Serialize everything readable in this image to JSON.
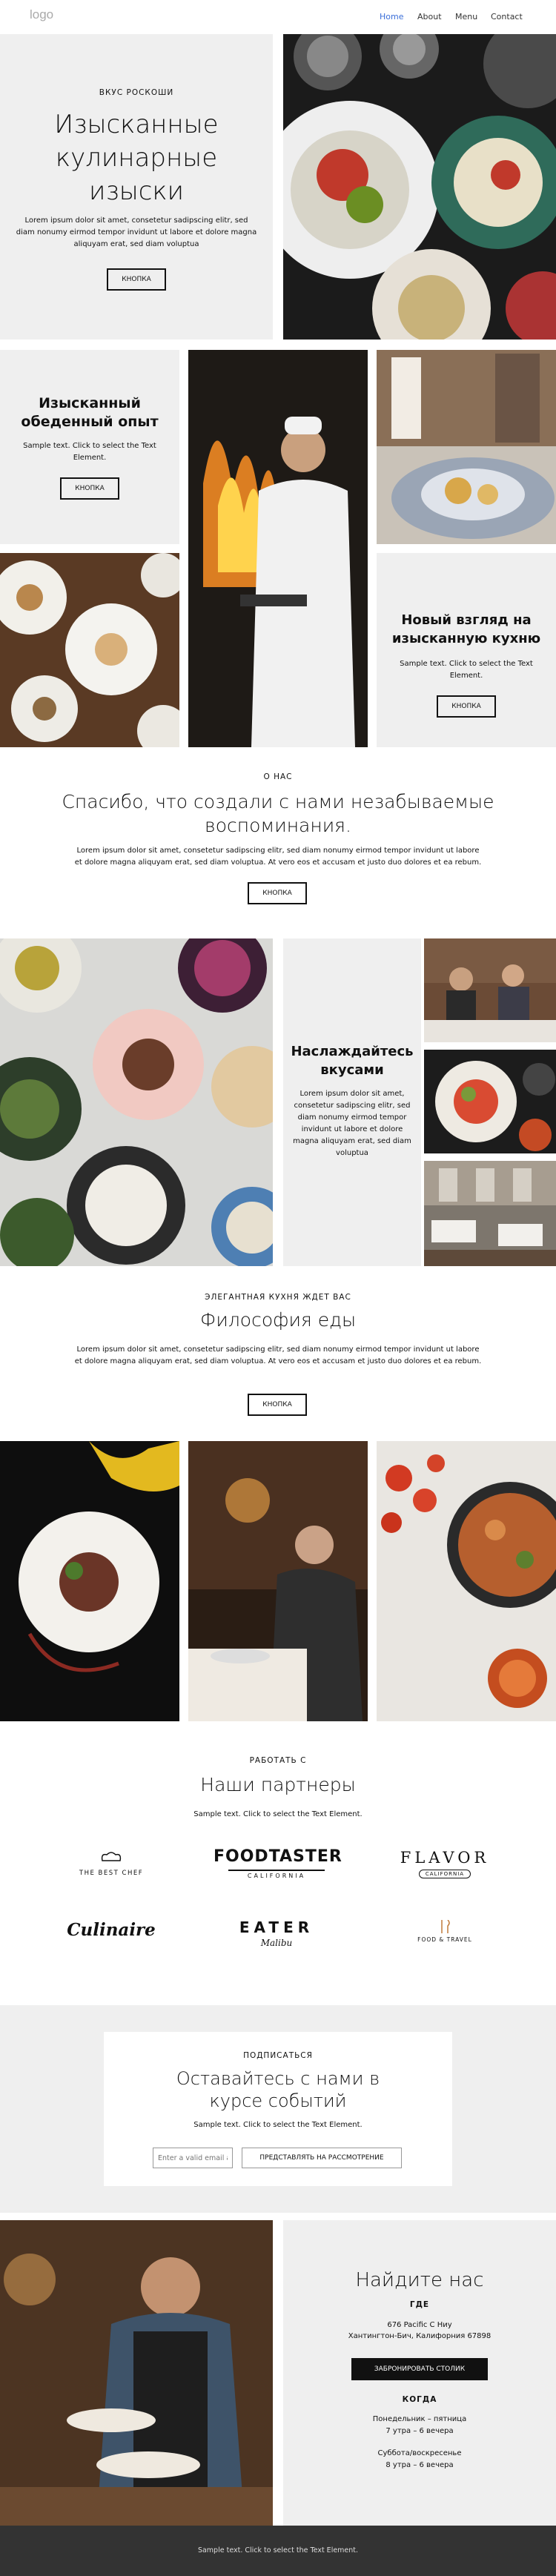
{
  "header": {
    "logo": "logo",
    "nav": [
      "Home",
      "About",
      "Menu",
      "Contact"
    ],
    "active_color": "#3b6fd9"
  },
  "hero": {
    "eyebrow": "ВКУС РОСКОШИ",
    "title": "Изысканные кулинарные изыски",
    "text": "Lorem ipsum dolor sit amet, consetetur sadipscing elitr, sed diam nonumy eirmod tempor invidunt ut labore et dolore magna aliquyam erat, sed diam voluptua",
    "button": "КНОПКА"
  },
  "block2": {
    "left_title": "Изысканный обеденный опыт",
    "left_text": "Sample text. Click to select the Text Element.",
    "left_button": "КНОПКА",
    "right_title": "Новый взгляд на изысканную кухню",
    "right_text": "Sample text. Click to select the Text Element.",
    "right_button": "КНОПКА"
  },
  "about": {
    "eyebrow": "О НАС",
    "title": "Спасибо, что создали с нами незабываемые воспоминания.",
    "text": "Lorem ipsum dolor sit amet, consetetur sadipscing elitr, sed diam nonumy eirmod tempor invidunt ut labore et dolore magna aliquyam erat, sed diam voluptua. At vero eos et accusam et justo duo dolores et ea rebum.",
    "button": "КНОПКА"
  },
  "enjoy": {
    "title": "Наслаждайтесь вкусами",
    "text": "Lorem ipsum dolor sit amet, consetetur sadipscing elitr, sed diam nonumy eirmod tempor invidunt ut labore et dolore magna aliquyam erat, sed diam voluptua"
  },
  "philosophy": {
    "eyebrow": "ЭЛЕГАНТНАЯ КУХНЯ ЖДЕТ ВАС",
    "title": "Философия еды",
    "text": "Lorem ipsum dolor sit amet, consetetur sadipscing elitr, sed diam nonumy eirmod tempor invidunt ut labore et dolore magna aliquyam erat, sed diam voluptua. At vero eos et accusam et justo duo dolores et ea rebum.",
    "button": "КНОПКА"
  },
  "partners": {
    "eyebrow": "РАБОТАТЬ С",
    "title": "Наши партнеры",
    "text": "Sample text. Click to select the Text Element.",
    "logos": [
      {
        "name": "THE BEST CHEF",
        "sub": ""
      },
      {
        "name": "FOODTASTER",
        "sub": "CALIFORNIA"
      },
      {
        "name": "FLAVOR",
        "sub": "CALIFORNIA"
      },
      {
        "name": "Culinaire",
        "sub": ""
      },
      {
        "name": "EATER",
        "sub": "Malibu"
      },
      {
        "name": "FOOD & TRAVEL",
        "sub": ""
      }
    ]
  },
  "subscribe": {
    "eyebrow": "ПОДПИСАТЬСЯ",
    "title": "Оставайтесь с нами в курсе событий",
    "text": "Sample text. Click to select the Text Element.",
    "placeholder": "Enter a valid email a",
    "button": "ПРЕДСТАВЛЯТЬ НА РАССМОТРЕНИЕ"
  },
  "find": {
    "title": "Найдите нас",
    "where_label": "ГДЕ",
    "address_line1": "676 Pacific C Ниу",
    "address_line2": "Хантингтон-Бич, Калифорния 67898",
    "button": "ЗАБРОНИРОВАТЬ СТОЛИК",
    "when_label": "КОГДА",
    "hours1_days": "Понедельник – пятница",
    "hours1_time": "7 утра – 6 вечера",
    "hours2_days": "Суббота/воскресенье",
    "hours2_time": "8 утра – 6 вечера"
  },
  "footer": {
    "text": "Sample text. Click to select the Text Element."
  }
}
